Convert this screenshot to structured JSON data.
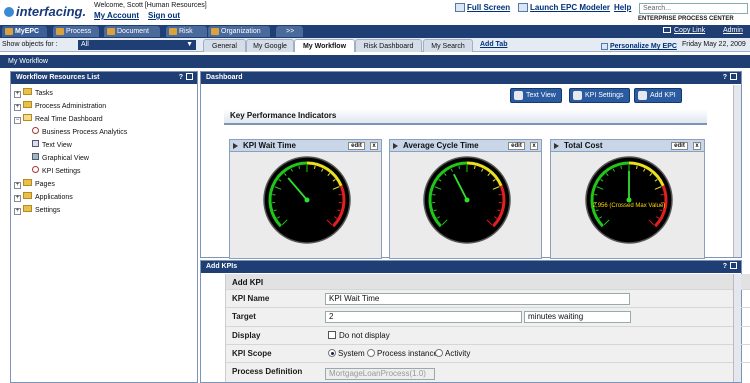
{
  "header": {
    "logo": "interfacing.",
    "welcome": "Welcome, Scott   [Human Resources]",
    "my_account": "My Account",
    "sign_out": "Sign out",
    "full_screen": "Full Screen",
    "launch": "Launch EPC Modeler",
    "help": "Help",
    "search_placeholder": "Search...",
    "product": "ENTERPRISE PROCESS CENTER",
    "copy_link": "Copy Link",
    "admin": "Admin"
  },
  "top_tabs": [
    {
      "label": "MyEPC"
    },
    {
      "label": "Process"
    },
    {
      "label": "Document"
    },
    {
      "label": "Risk"
    },
    {
      "label": "Organization"
    },
    {
      "label": ">>"
    }
  ],
  "subbar": {
    "show_label": "Show objects for :",
    "show_value": "All",
    "tabs": [
      {
        "label": "General"
      },
      {
        "label": "My Google"
      },
      {
        "label": "My Workflow"
      },
      {
        "label": "Risk Dashboard"
      },
      {
        "label": "My Search"
      }
    ],
    "add_tab": "Add Tab",
    "personalize": "Personalize My EPC",
    "date": "Friday May 22, 2009"
  },
  "workflow_bar": "My Workflow",
  "left_panel": {
    "title": "Workflow Resources List",
    "items": [
      {
        "label": "Tasks"
      },
      {
        "label": "Process Administration"
      },
      {
        "label": "Real Time Dashboard"
      },
      {
        "label": "Business Process Analytics"
      },
      {
        "label": "Text View"
      },
      {
        "label": "Graphical View"
      },
      {
        "label": "KPI Settings"
      },
      {
        "label": "Pages"
      },
      {
        "label": "Applications"
      },
      {
        "label": "Settings"
      }
    ]
  },
  "dashboard": {
    "title": "Dashboard",
    "buttons": {
      "text_view": "Text View",
      "kpi_settings": "KPI Settings",
      "add_kpi": "Add KPI"
    },
    "kpi_section": "Key Performance Indicators",
    "edit": "edit",
    "close": "x",
    "gauges": [
      {
        "title": "KPI Wait Time",
        "value_fraction": 0.35
      },
      {
        "title": "Average Cycle Time",
        "value_fraction": 0.4
      },
      {
        "title": "Total Cost",
        "value_fraction": 0.5,
        "label": "2,956 (Crossed Max Value)"
      }
    ]
  },
  "add_kpis": {
    "title": "Add KPIs",
    "section": "Add KPI",
    "rows": {
      "name_label": "KPI Name",
      "name_value": "KPI Wait Time",
      "target_label": "Target",
      "target_value": "2",
      "target_unit": "minutes waiting",
      "display_label": "Display",
      "display_option": "Do not display",
      "scope_label": "KPI Scope",
      "scope_options": [
        "System",
        "Process instance",
        "Activity"
      ],
      "procdef_label": "Process Definition",
      "procdef_value": "MortgageLoanProcess(1.0)"
    }
  },
  "colors": {
    "navy": "#1f3e73",
    "accent": "#2a5aa0"
  }
}
